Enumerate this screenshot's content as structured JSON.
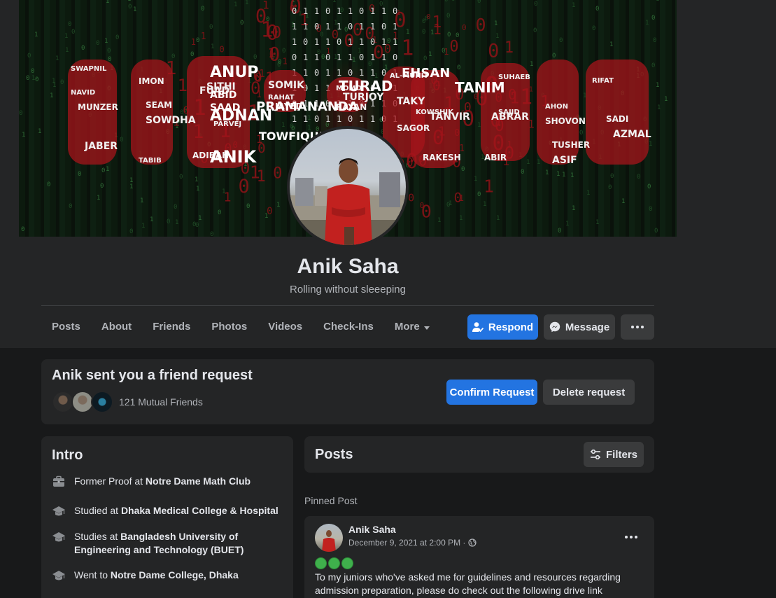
{
  "profile": {
    "name": "Anik Saha",
    "bio": "Rolling without sleeeping"
  },
  "nav": {
    "tabs": [
      "Posts",
      "About",
      "Friends",
      "Photos",
      "Videos",
      "Check-Ins",
      "More"
    ],
    "respond_label": "Respond",
    "message_label": "Message"
  },
  "friend_request": {
    "title": "Anik sent you a friend request",
    "mutual": "121 Mutual Friends",
    "confirm_label": "Confirm Request",
    "delete_label": "Delete request"
  },
  "intro": {
    "title": "Intro",
    "items": [
      {
        "icon": "briefcase-icon",
        "prefix": "Former Proof at ",
        "bold": "Notre Dame Math Club"
      },
      {
        "icon": "graduation-cap-icon",
        "prefix": "Studied at ",
        "bold": "Dhaka Medical College & Hospital"
      },
      {
        "icon": "graduation-cap-icon",
        "prefix": "Studies at ",
        "bold": "Bangladesh University of Engineering and Technology (BUET)"
      },
      {
        "icon": "graduation-cap-icon",
        "prefix": "Went to ",
        "bold": "Notre Dame College, Dhaka"
      }
    ]
  },
  "posts": {
    "title": "Posts",
    "filters_label": "Filters",
    "pinned_label": "Pinned Post",
    "post": {
      "author": "Anik Saha",
      "date": "December 9, 2021 at 2:00 PM · ",
      "text": "To my juniors who've asked me for guidelines and resources regarding admission preparation, please do check out the following drive link"
    }
  },
  "cover": {
    "words_white": [
      "ANUP",
      "ADNAN",
      "PRAMANANDA",
      "ANIK",
      "TURAD",
      "TANIM",
      "EHSAN",
      "ABID",
      "SAAD",
      "TOWFIQUE"
    ],
    "words_small": [
      "SWAPNIL",
      "IMON",
      "FUAD",
      "SAJID",
      "SHOVON",
      "AZMAL",
      "RAHAT",
      "RAYAN",
      "TAKY",
      "KOWSHIK",
      "MUNZER",
      "SOWDHA",
      "PARVEJ",
      "ABIR",
      "ASIF",
      "RIFAT",
      "JAYED",
      "TURJOY",
      "AL-MUHIT",
      "RAKESH",
      "JABER",
      "TABIB",
      "ADIBAH",
      "ABRAR",
      "AHON",
      "SADI",
      "SOMIK",
      "MOMO",
      "SAGOR",
      "TANVIR",
      "NAVID",
      "SEAM",
      "SITHI",
      "SUHAEB",
      "TUSHER"
    ]
  },
  "colors": {
    "accent": "#2374e1",
    "surface": "#242526",
    "background": "#18191a",
    "cover_red": "#b3141c"
  }
}
